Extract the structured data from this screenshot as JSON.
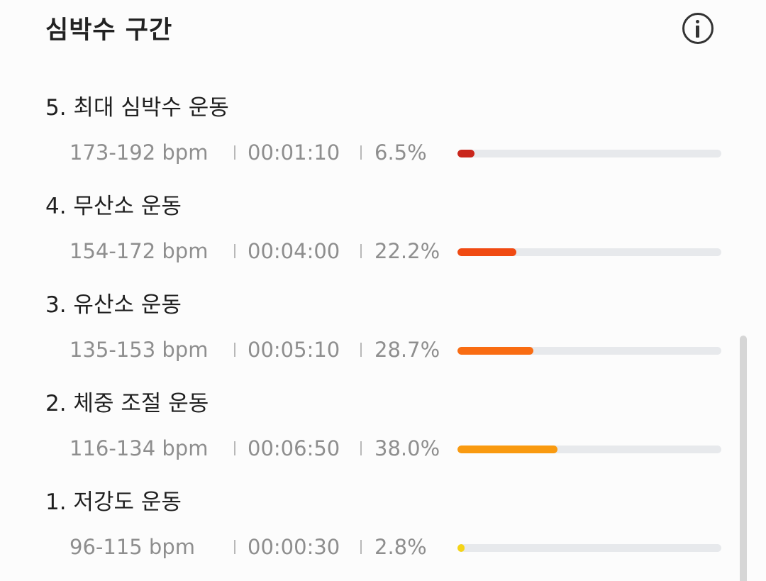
{
  "header": {
    "title": "심박수 구간",
    "info_icon": "info-circle-icon"
  },
  "zones": [
    {
      "name": "5. 최대 심박수 운동",
      "range": "173-192 bpm",
      "time": "00:01:10",
      "percent_label": "6.5%",
      "percent": 6.5,
      "color": "#c9261b"
    },
    {
      "name": "4. 무산소 운동",
      "range": "154-172 bpm",
      "time": "00:04:00",
      "percent_label": "22.2%",
      "percent": 22.2,
      "color": "#f04a12"
    },
    {
      "name": "3. 유산소 운동",
      "range": "135-153 bpm",
      "time": "00:05:10",
      "percent_label": "28.7%",
      "percent": 28.7,
      "color": "#f96c12"
    },
    {
      "name": "2. 체중 조절 운동",
      "range": "116-134 bpm",
      "time": "00:06:50",
      "percent_label": "38.0%",
      "percent": 38.0,
      "color": "#f99a10"
    },
    {
      "name": "1. 저강도 운동",
      "range": "96-115 bpm",
      "time": "00:00:30",
      "percent_label": "2.8%",
      "percent": 2.8,
      "color": "#f5d417"
    }
  ]
}
